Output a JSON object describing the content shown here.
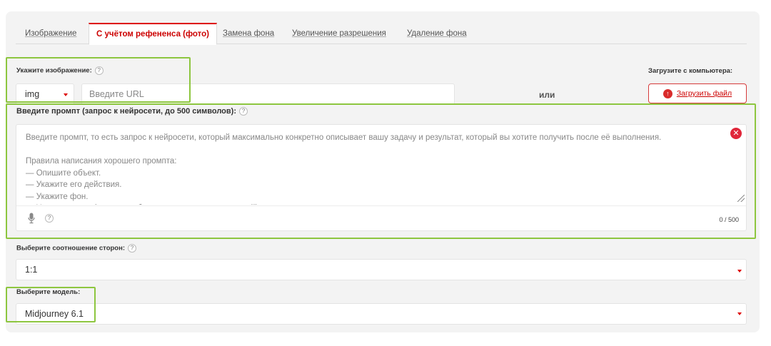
{
  "tabs": [
    {
      "label": "Изображение",
      "active": false
    },
    {
      "label": "С учётом рефененса (фото)",
      "active": true
    },
    {
      "label": "Замена фона",
      "active": false
    },
    {
      "label": "Увеличение разрешения",
      "active": false
    },
    {
      "label": "Удаление фона",
      "active": false
    }
  ],
  "image_source": {
    "label": "Укажите изображение:",
    "help": "?",
    "type_value": "img",
    "url_placeholder": "Введите URL",
    "or_text": "или",
    "upload_label": "Загрузите с компьютера:",
    "upload_button": "Загрузить файл"
  },
  "prompt": {
    "label": "Введите промпт (запрос к нейросети, до 500 символов):",
    "help": "?",
    "placeholder": "Введите промпт, то есть запрос к нейросети, который максимально конкретно описывает вашу задачу и результат, который вы хотите получить после её выполнения.\n\nПравила написания хорошего промпта:\n— Опишите объект.\n— Укажите его действия.\n— Укажите фон.\n— Укажите стиль (можно комбинацию из нескольких стилей).",
    "counter": "0 / 500",
    "mic_help": "?"
  },
  "aspect": {
    "label": "Выберите соотношение сторон:",
    "help": "?",
    "value": "1:1"
  },
  "model": {
    "label": "Выберите модель:",
    "value": "Midjourney 6.1"
  },
  "colors": {
    "accent": "#d00000",
    "highlight": "#8dc63f",
    "panel": "#f3f3f3"
  }
}
